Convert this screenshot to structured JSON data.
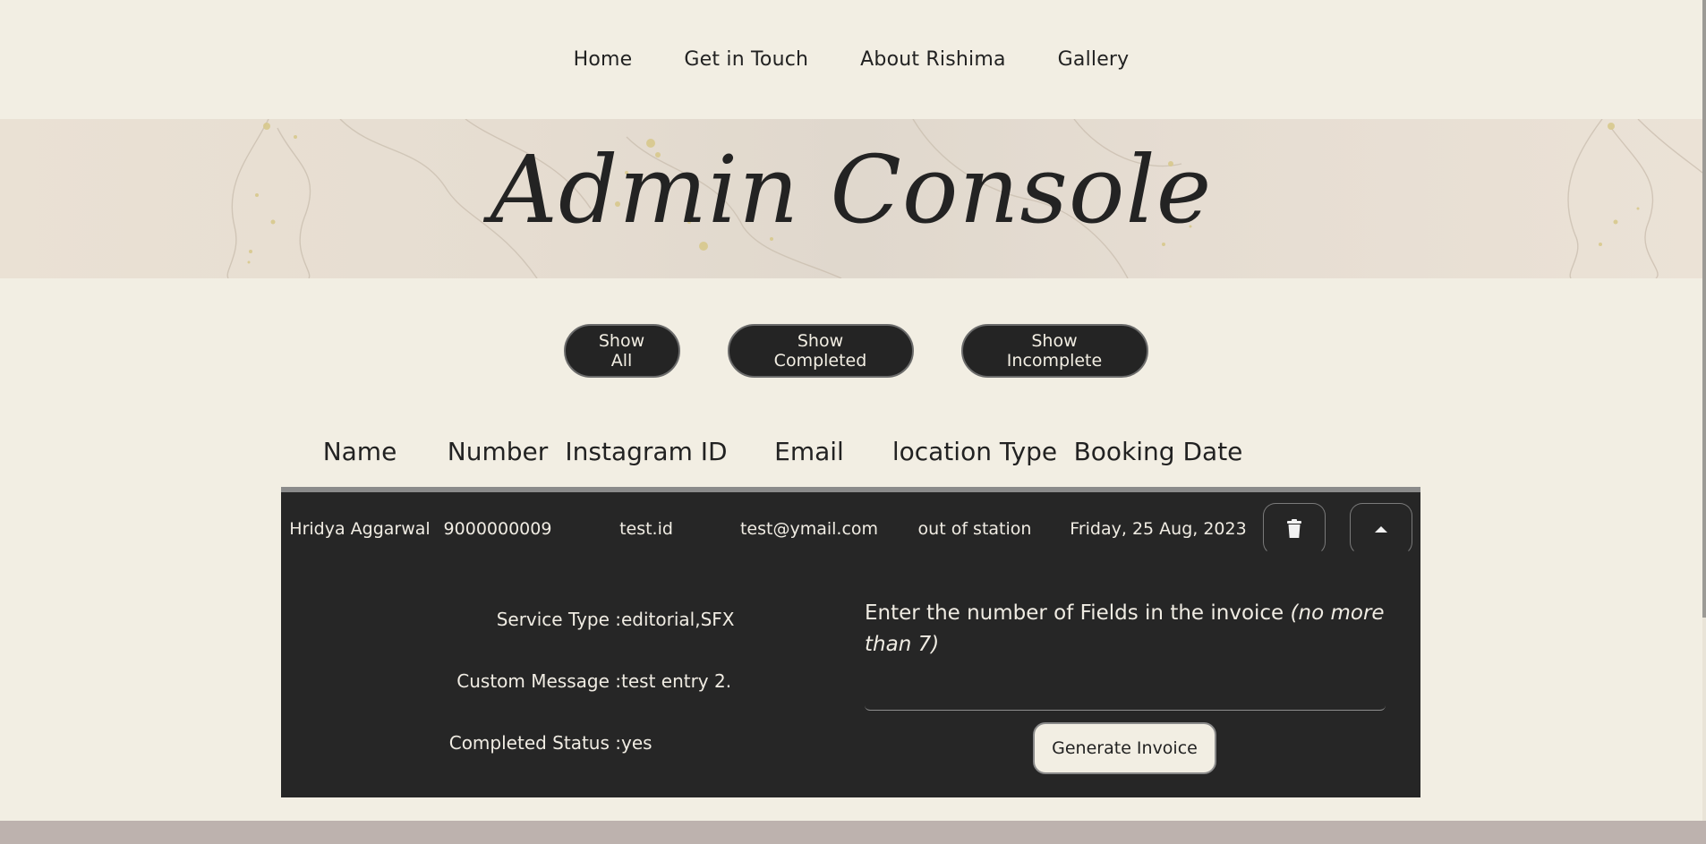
{
  "nav": {
    "items": [
      "Home",
      "Get in Touch",
      "About Rishima",
      "Gallery"
    ]
  },
  "banner": {
    "title": "Admin Console"
  },
  "filters": {
    "show_all": "Show All",
    "show_completed": "Show Completed",
    "show_incomplete": "Show Incomplete"
  },
  "table": {
    "columns": [
      "Name",
      "Number",
      "Instagram ID",
      "Email",
      "location Type",
      "Booking Date"
    ],
    "rows": [
      {
        "name": "Hridya Aggarwal",
        "number": "9000000009",
        "instagram_id": "test.id",
        "email": "test@ymail.com",
        "location_type": "out of station",
        "booking_date": "Friday, 25 Aug, 2023",
        "delete_icon": "trash-icon",
        "collapse_icon": "caret-up-icon",
        "details": {
          "service_type_label": "Service Type :",
          "service_type": "editorial,SFX",
          "custom_message_label": "Custom Message :",
          "custom_message": "test entry 2.",
          "completed_status_label": "Completed Status :",
          "completed_status": "yes"
        },
        "invoice": {
          "prompt": "Enter the number of Fields in the invoice",
          "prompt_note": "(no more than 7)",
          "field_value": "",
          "generate_label": "Generate Invoice"
        }
      }
    ]
  },
  "colors": {
    "page_bg": "#f2eee3",
    "panel_bg": "#262626",
    "button_bg": "#242424",
    "footer_band": "#bdb2ae"
  }
}
